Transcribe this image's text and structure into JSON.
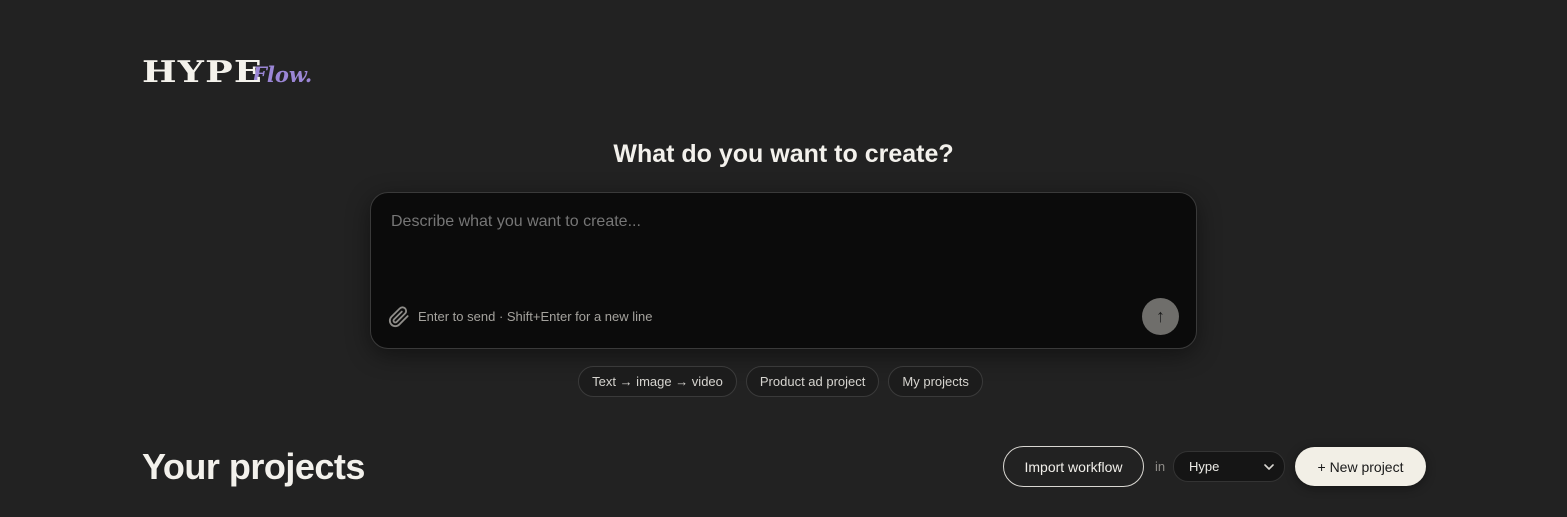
{
  "brand": {
    "logo_text": "HYPE",
    "logo_sub": "Flow.",
    "accent_color": "#9b86d6"
  },
  "hero": {
    "title": "What do you want to create?",
    "placeholder": "Describe what you want to create...",
    "hint": "Enter to send · Shift+Enter for a new line",
    "attach_icon": "paperclip-icon",
    "send_icon": "arrow-up-icon",
    "send_symbol": "↑"
  },
  "suggestions": [
    {
      "label": "Text → image → video"
    },
    {
      "label": "Product ad project"
    },
    {
      "label": "My projects"
    }
  ],
  "projects": {
    "title": "Your projects",
    "import_label": "Import workflow",
    "in_label": "in",
    "workspace": "Hype",
    "new_label": "+ New project"
  }
}
